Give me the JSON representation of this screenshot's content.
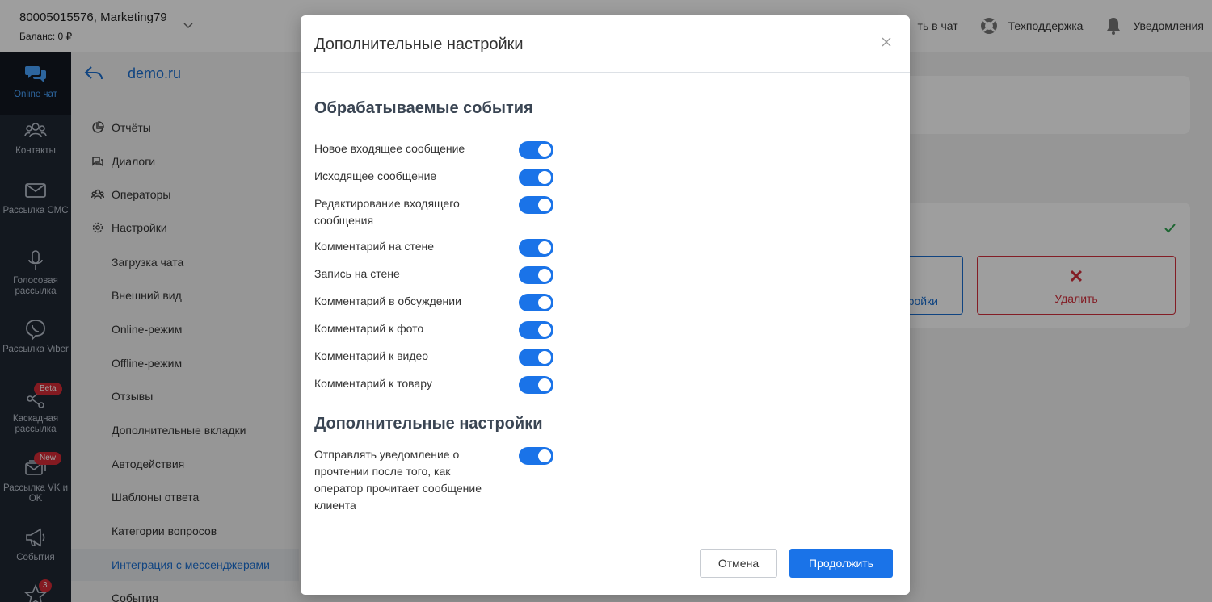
{
  "header": {
    "account_name": "80005015576, Marketing79",
    "balance": "Баланс: 0 ₽",
    "actions": {
      "chat": "ть в чат",
      "support": "Техподдержка",
      "notifications": "Уведомления"
    }
  },
  "rail": {
    "items": [
      {
        "label": "Online чат",
        "icon": "chat-bubbles-icon"
      },
      {
        "label": "Контакты",
        "icon": "contacts-icon"
      },
      {
        "label": "Рассылка СМС",
        "icon": "mail-icon"
      },
      {
        "label": "Голосовая рассылка",
        "icon": "microphone-icon"
      },
      {
        "label": "Рассылка Viber",
        "icon": "viber-icon"
      },
      {
        "label": "Каскадная рассылка",
        "icon": "share-icon",
        "badge": "Beta"
      },
      {
        "label": "Рассылка VK и OK",
        "icon": "mail-stack-icon",
        "badge": "New"
      },
      {
        "label": "События",
        "icon": "megaphone-icon"
      },
      {
        "label": "",
        "icon": "star-icon",
        "badge": "3"
      }
    ]
  },
  "subnav": {
    "title": "demo.ru",
    "items": [
      "Отчёты",
      "Диалоги",
      "Операторы",
      "Настройки",
      "Загрузка чата",
      "Внешний вид",
      "Online-режим",
      "Offline-режим",
      "Отзывы",
      "Дополнительные вкладки",
      "Автодействия",
      "Шаблоны ответа",
      "Категории вопросов",
      "Интеграция с мессенджерами",
      "События"
    ]
  },
  "background": {
    "partial_button": "ройки",
    "delete_button": "Удалить"
  },
  "modal": {
    "title": "Дополнительные настройки",
    "section_events": "Обрабатываемые события",
    "events": [
      {
        "label": "Новое входящее сообщение",
        "enabled": true
      },
      {
        "label": "Исходящее сообщение",
        "enabled": true
      },
      {
        "label": "Редактирование входящего сообщения",
        "enabled": true
      },
      {
        "label": "Комментарий на стене",
        "enabled": true
      },
      {
        "label": "Запись на стене",
        "enabled": true
      },
      {
        "label": "Комментарий в обсуждении",
        "enabled": true
      },
      {
        "label": "Комментарий к фото",
        "enabled": true
      },
      {
        "label": "Комментарий к видео",
        "enabled": true
      },
      {
        "label": "Комментарий к товару",
        "enabled": true
      }
    ],
    "section_extra": "Дополнительные настройки",
    "extra": [
      {
        "label": "Отправлять уведомление о прочтении после того, как оператор прочитает сообщение клиента",
        "enabled": true
      }
    ],
    "cancel_label": "Отмена",
    "continue_label": "Продолжить"
  },
  "colors": {
    "accent": "#1a73e8",
    "rail_bg": "#1f2733",
    "danger": "#d4303c"
  }
}
